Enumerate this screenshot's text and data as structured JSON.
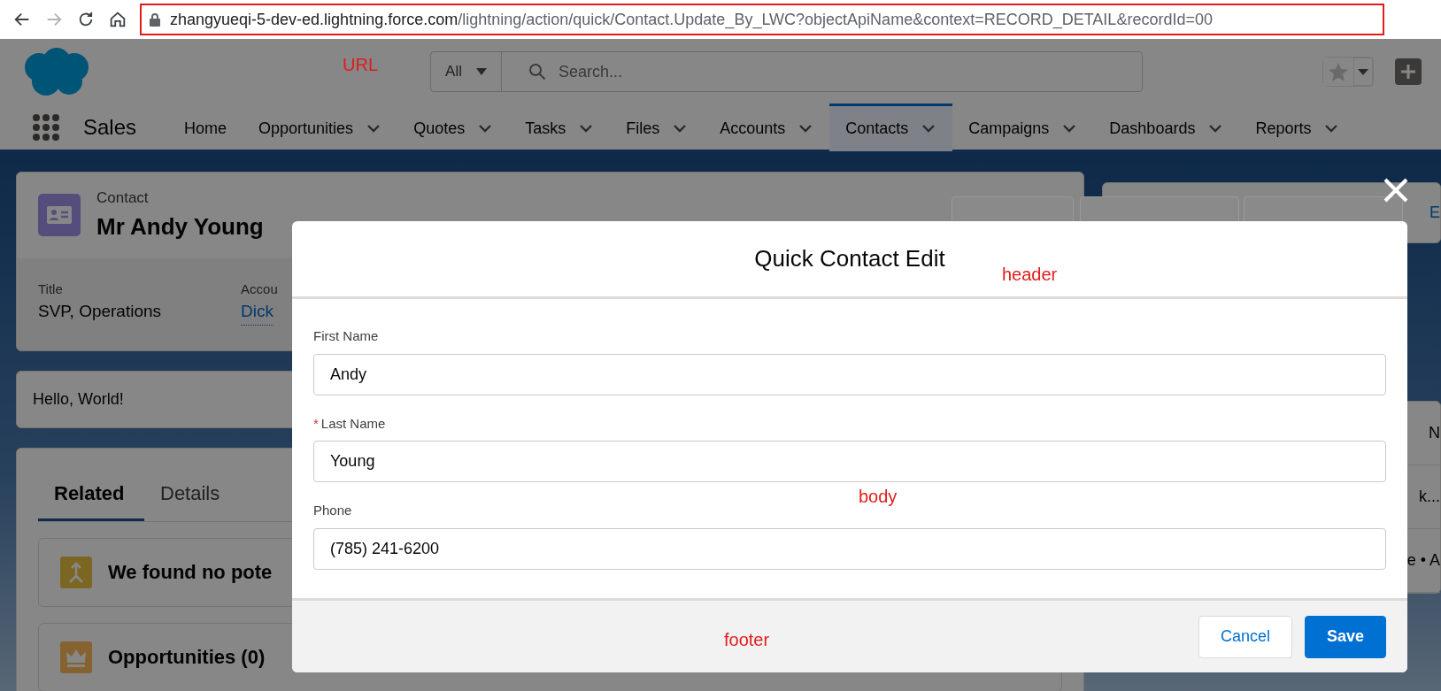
{
  "browser": {
    "url_host": "zhangyueqi-5-dev-ed.lightning.force.com",
    "url_path": "/lightning/action/quick/Contact.Update_By_LWC?objectApiName&context=RECORD_DETAIL&recordId=00"
  },
  "annotations": {
    "url": "URL",
    "header": "header",
    "body": "body",
    "footer": "footer"
  },
  "header": {
    "search_scope": "All",
    "search_placeholder": "Search..."
  },
  "nav": {
    "app_name": "Sales",
    "items": [
      {
        "label": "Home",
        "dropdown": false,
        "selected": false
      },
      {
        "label": "Opportunities",
        "dropdown": true,
        "selected": false
      },
      {
        "label": "Quotes",
        "dropdown": true,
        "selected": false
      },
      {
        "label": "Tasks",
        "dropdown": true,
        "selected": false
      },
      {
        "label": "Files",
        "dropdown": true,
        "selected": false
      },
      {
        "label": "Accounts",
        "dropdown": true,
        "selected": false
      },
      {
        "label": "Contacts",
        "dropdown": true,
        "selected": true
      },
      {
        "label": "Campaigns",
        "dropdown": true,
        "selected": false
      },
      {
        "label": "Dashboards",
        "dropdown": true,
        "selected": false
      },
      {
        "label": "Reports",
        "dropdown": true,
        "selected": false
      }
    ]
  },
  "record": {
    "object": "Contact",
    "name": "Mr Andy Young",
    "fields": [
      {
        "label": "Title",
        "value": "SVP, Operations",
        "link": false
      },
      {
        "label": "Accou",
        "value": "Dick",
        "link": true
      }
    ],
    "action_fragment": "E"
  },
  "hello": "Hello, World!",
  "tabs": [
    {
      "label": "Related",
      "selected": true
    },
    {
      "label": "Details",
      "selected": false
    }
  ],
  "related_cards": [
    {
      "title": "We found no pote",
      "kind": "duplicates"
    },
    {
      "title": "Opportunities (0)",
      "kind": "opportunities"
    }
  ],
  "side_fragments": [
    "N",
    "k...",
    "e • A"
  ],
  "modal": {
    "title": "Quick Contact Edit",
    "fields": [
      {
        "label": "First Name",
        "value": "Andy"
      },
      {
        "label": "Last Name",
        "value": "Young",
        "required_mark": "*"
      },
      {
        "label": "Phone",
        "value": "(785) 241-6200"
      }
    ],
    "buttons": [
      {
        "label": "Cancel",
        "kind": "neutral"
      },
      {
        "label": "Save",
        "kind": "brand"
      }
    ]
  }
}
